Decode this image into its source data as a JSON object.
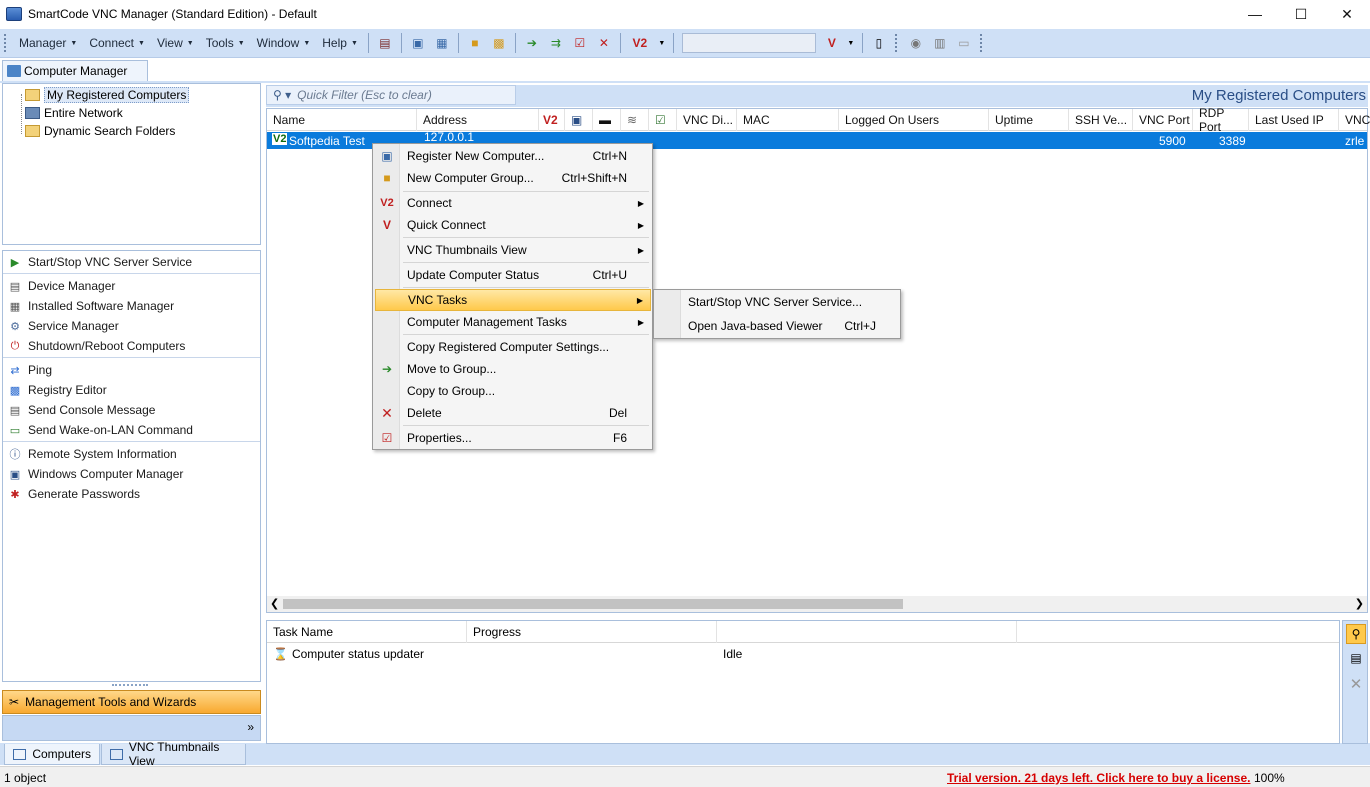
{
  "window": {
    "title": "SmartCode VNC Manager (Standard Edition) - Default",
    "minimize": "—",
    "maximize": "☐",
    "close": "✕"
  },
  "menubar": {
    "items": [
      "Manager",
      "Connect",
      "View",
      "Tools",
      "Window",
      "Help"
    ]
  },
  "left_tab": "Computer Manager",
  "tree": {
    "items": [
      "My Registered Computers",
      "Entire Network",
      "Dynamic Search Folders"
    ]
  },
  "tasks": {
    "groups": [
      [
        "Start/Stop VNC Server Service"
      ],
      [
        "Device Manager",
        "Installed Software Manager",
        "Service Manager",
        "Shutdown/Reboot Computers"
      ],
      [
        "Ping",
        "Registry Editor",
        "Send Console Message",
        "Send Wake-on-LAN Command"
      ],
      [
        "Remote System Information",
        "Windows Computer Manager",
        "Generate Passwords"
      ]
    ],
    "panel_title": "Management Tools and Wizards"
  },
  "bottom_tabs": [
    "Computers",
    "VNC Thumbnails View"
  ],
  "status": {
    "objects": "1 object",
    "trial": "Trial version. 21 days left. Click here to buy a license.",
    "zoom": "100%"
  },
  "main": {
    "filter_placeholder": "Quick Filter (Esc to clear)",
    "title": "My Registered Computers",
    "columns": [
      "Name",
      "Address",
      "VNC Di...",
      "MAC",
      "Logged On Users",
      "Uptime",
      "SSH Ve...",
      "VNC Port",
      "RDP Port",
      "Last Used IP",
      "VNC"
    ],
    "row": {
      "name": "Softpedia Test",
      "address": "127.0.0.1",
      "vnc_port": "5900",
      "rdp_port": "3389",
      "vnc": "zrle"
    }
  },
  "taskgrid": {
    "columns": [
      "Task Name",
      "Progress"
    ],
    "row": {
      "name": "Computer status updater",
      "status": "Idle"
    }
  },
  "context_menu": {
    "items": [
      {
        "label": "Register New Computer...",
        "shortcut": "Ctrl+N"
      },
      {
        "label": "New Computer Group...",
        "shortcut": "Ctrl+Shift+N"
      },
      {
        "label": "Connect",
        "shortcut": ""
      },
      {
        "label": "Quick Connect",
        "shortcut": ""
      },
      {
        "label": "VNC Thumbnails View",
        "shortcut": ""
      },
      {
        "label": "Update Computer Status",
        "shortcut": "Ctrl+U"
      },
      {
        "label": "VNC Tasks",
        "shortcut": ""
      },
      {
        "label": "Computer Management Tasks",
        "shortcut": ""
      },
      {
        "label": "Copy Registered Computer Settings...",
        "shortcut": ""
      },
      {
        "label": "Move to Group...",
        "shortcut": ""
      },
      {
        "label": "Copy to Group...",
        "shortcut": ""
      },
      {
        "label": "Delete",
        "shortcut": "Del"
      },
      {
        "label": "Properties...",
        "shortcut": "F6"
      }
    ],
    "submenu": [
      {
        "label": "Start/Stop VNC Server Service...",
        "shortcut": ""
      },
      {
        "label": "Open Java-based Viewer",
        "shortcut": "Ctrl+J"
      }
    ]
  },
  "colors": {
    "accent": "#0a7bdc",
    "toolbar": "#cfe0f6",
    "highlight": "#ffc94b",
    "trial": "#d60000"
  }
}
